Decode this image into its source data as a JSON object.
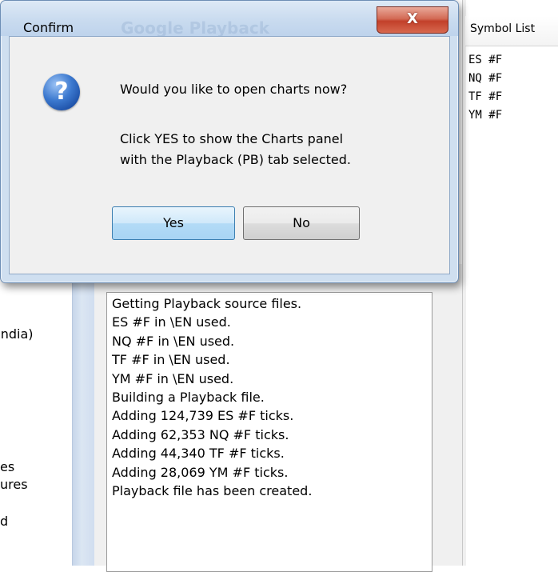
{
  "dialog": {
    "title": "Confirm",
    "title_background": "Google Playback",
    "close_glyph": "X",
    "icon": "question-icon",
    "question": "Would you like to open charts now?",
    "info_line1": "Click YES to show the Charts panel",
    "info_line2": "with the Playback (PB) tab selected.",
    "yes_label": "Yes",
    "no_label": "No"
  },
  "left_panel": {
    "fragments": [
      "India)",
      "es",
      "ures",
      "d"
    ]
  },
  "log": {
    "lines": [
      "Getting Playback source files.",
      "ES #F in \\EN used.",
      "NQ #F in \\EN used.",
      "TF #F in \\EN used.",
      "YM #F in \\EN used.",
      "Building a Playback file.",
      "Adding 124,739 ES #F ticks.",
      "Adding 62,353 NQ #F ticks.",
      "Adding 44,340 TF #F ticks.",
      "Adding 28,069 YM #F ticks.",
      "Playback file has been created."
    ]
  },
  "symbol_list": {
    "header": "Symbol List",
    "items": [
      "ES #F",
      "NQ #F",
      "TF #F",
      "YM #F"
    ]
  },
  "colors": {
    "accent_blue": "#3c7fb1",
    "close_red": "#c2402a",
    "dialog_frame": "#cfdff0"
  }
}
